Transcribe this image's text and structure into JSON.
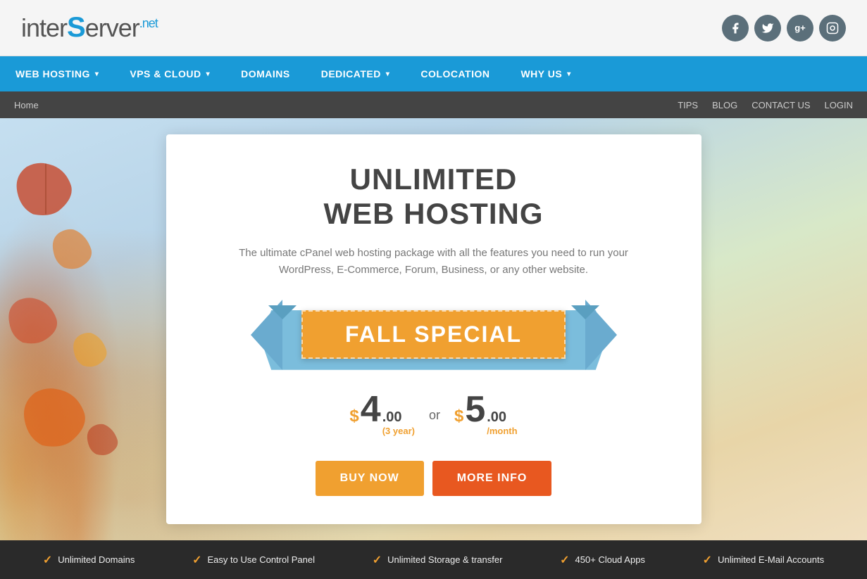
{
  "header": {
    "logo": {
      "text_inter": "inter",
      "text_S": "S",
      "text_erver": "erver",
      "text_net": ".net"
    },
    "social": [
      {
        "name": "facebook",
        "icon": "f"
      },
      {
        "name": "twitter",
        "icon": "t"
      },
      {
        "name": "google-plus",
        "icon": "g+"
      },
      {
        "name": "instagram",
        "icon": "in"
      }
    ]
  },
  "nav": {
    "items": [
      {
        "label": "WEB HOSTING",
        "has_dropdown": true
      },
      {
        "label": "VPS & CLOUD",
        "has_dropdown": true
      },
      {
        "label": "DOMAINS",
        "has_dropdown": false
      },
      {
        "label": "DEDICATED",
        "has_dropdown": true
      },
      {
        "label": "COLOCATION",
        "has_dropdown": false
      },
      {
        "label": "WHY US",
        "has_dropdown": true
      }
    ]
  },
  "breadcrumb": {
    "home": "Home",
    "links": [
      "TIPS",
      "BLOG",
      "CONTACT US",
      "LOGIN"
    ]
  },
  "hero": {
    "card": {
      "title_line1": "UNLIMITED",
      "title_line2": "WEB HOSTING",
      "subtitle": "The ultimate cPanel web hosting package with all the features you need to run your WordPress, E-Commerce, Forum, Business, or any other website.",
      "banner_text": "FALL SPECIAL",
      "price1_dollar": "$",
      "price1_amount": "4",
      "price1_cents": ".00",
      "price1_period": "(3 year)",
      "price_or": "or",
      "price2_dollar": "$",
      "price2_amount": "5",
      "price2_cents": ".00",
      "price2_period": "/month",
      "btn_buy": "BUY NOW",
      "btn_info": "MORE INFO"
    }
  },
  "features": [
    {
      "icon": "✓",
      "text": "Unlimited Domains"
    },
    {
      "icon": "✓",
      "text": "Easy to Use Control Panel"
    },
    {
      "icon": "✓",
      "text": "Unlimited Storage & transfer"
    },
    {
      "icon": "✓",
      "text": "450+ Cloud Apps"
    },
    {
      "icon": "✓",
      "text": "Unlimited E-Mail Accounts"
    }
  ]
}
